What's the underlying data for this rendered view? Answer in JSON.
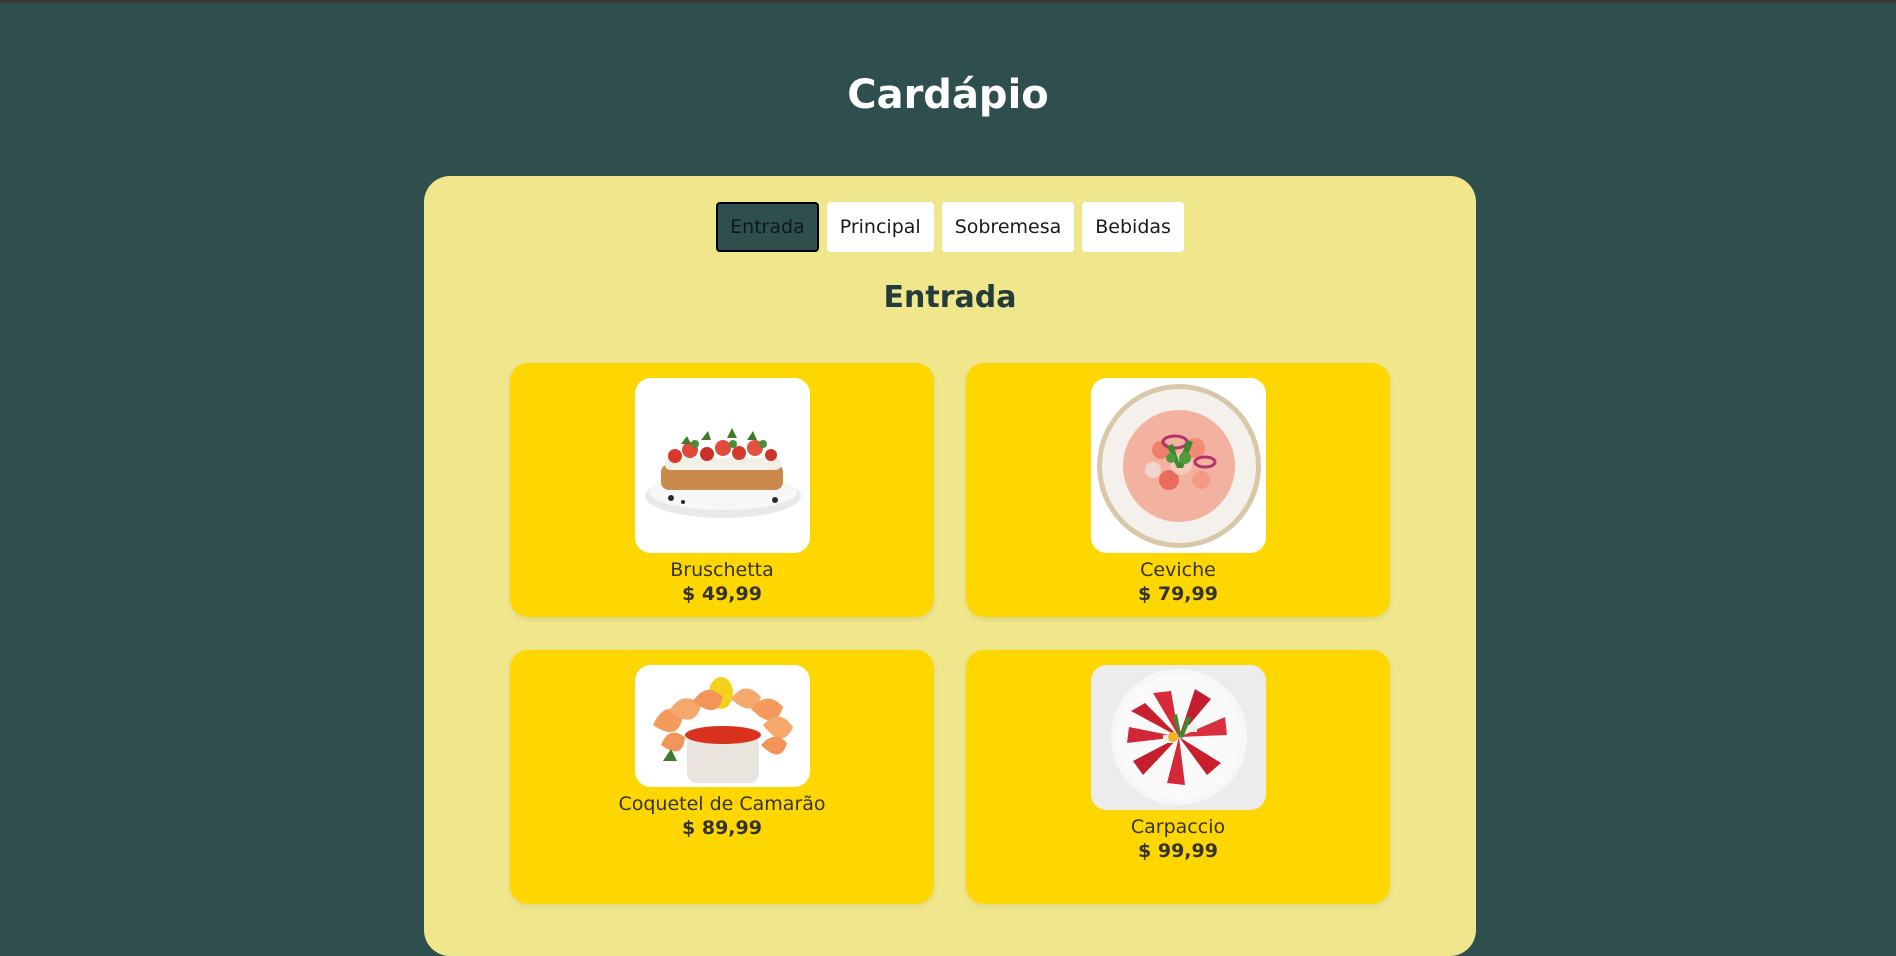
{
  "page": {
    "title": "Cardápio"
  },
  "tabs": [
    {
      "label": "Entrada",
      "active": true
    },
    {
      "label": "Principal",
      "active": false
    },
    {
      "label": "Sobremesa",
      "active": false
    },
    {
      "label": "Bebidas",
      "active": false
    }
  ],
  "section": {
    "title": "Entrada"
  },
  "items": [
    {
      "name": "Bruschetta",
      "price": "$ 49,99"
    },
    {
      "name": "Ceviche",
      "price": "$ 79,99"
    },
    {
      "name": "Coquetel de Camarão",
      "price": "$ 89,99"
    },
    {
      "name": "Carpaccio",
      "price": "$ 99,99"
    }
  ],
  "colors": {
    "background": "#2f4f4f",
    "panel": "#f0e68c",
    "card": "#ffd700",
    "active_tab": "#2f4f4f"
  }
}
